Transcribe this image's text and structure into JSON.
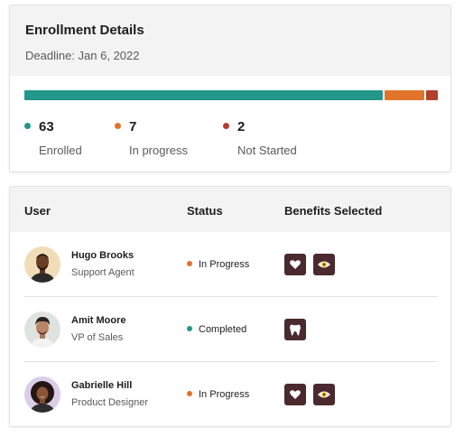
{
  "colors": {
    "enrolled": "#22978a",
    "in_progress": "#e0742a",
    "not_started": "#b3402a",
    "benefit_bg": "#4a2a2e"
  },
  "summary": {
    "title": "Enrollment Details",
    "deadline": "Deadline: Jan 6, 2022",
    "stats": [
      {
        "value": "63",
        "label": "Enrolled",
        "count": 63
      },
      {
        "value": "7",
        "label": "In progress",
        "count": 7
      },
      {
        "value": "2",
        "label": "Not Started",
        "count": 2
      }
    ]
  },
  "table": {
    "columns": [
      "User",
      "Status",
      "Benefits Selected"
    ],
    "rows": [
      {
        "name": "Hugo Brooks",
        "role": "Support Agent",
        "status": "In Progress",
        "status_color": "#e0742a",
        "benefits": [
          "heart-icon",
          "eye-icon"
        ]
      },
      {
        "name": "Amit Moore",
        "role": "VP of Sales",
        "status": "Completed",
        "status_color": "#22978a",
        "benefits": [
          "tooth-icon"
        ]
      },
      {
        "name": "Gabrielle Hill",
        "role": "Product Designer",
        "status": "In Progress",
        "status_color": "#e0742a",
        "benefits": [
          "heart-icon",
          "eye-icon"
        ]
      }
    ]
  }
}
